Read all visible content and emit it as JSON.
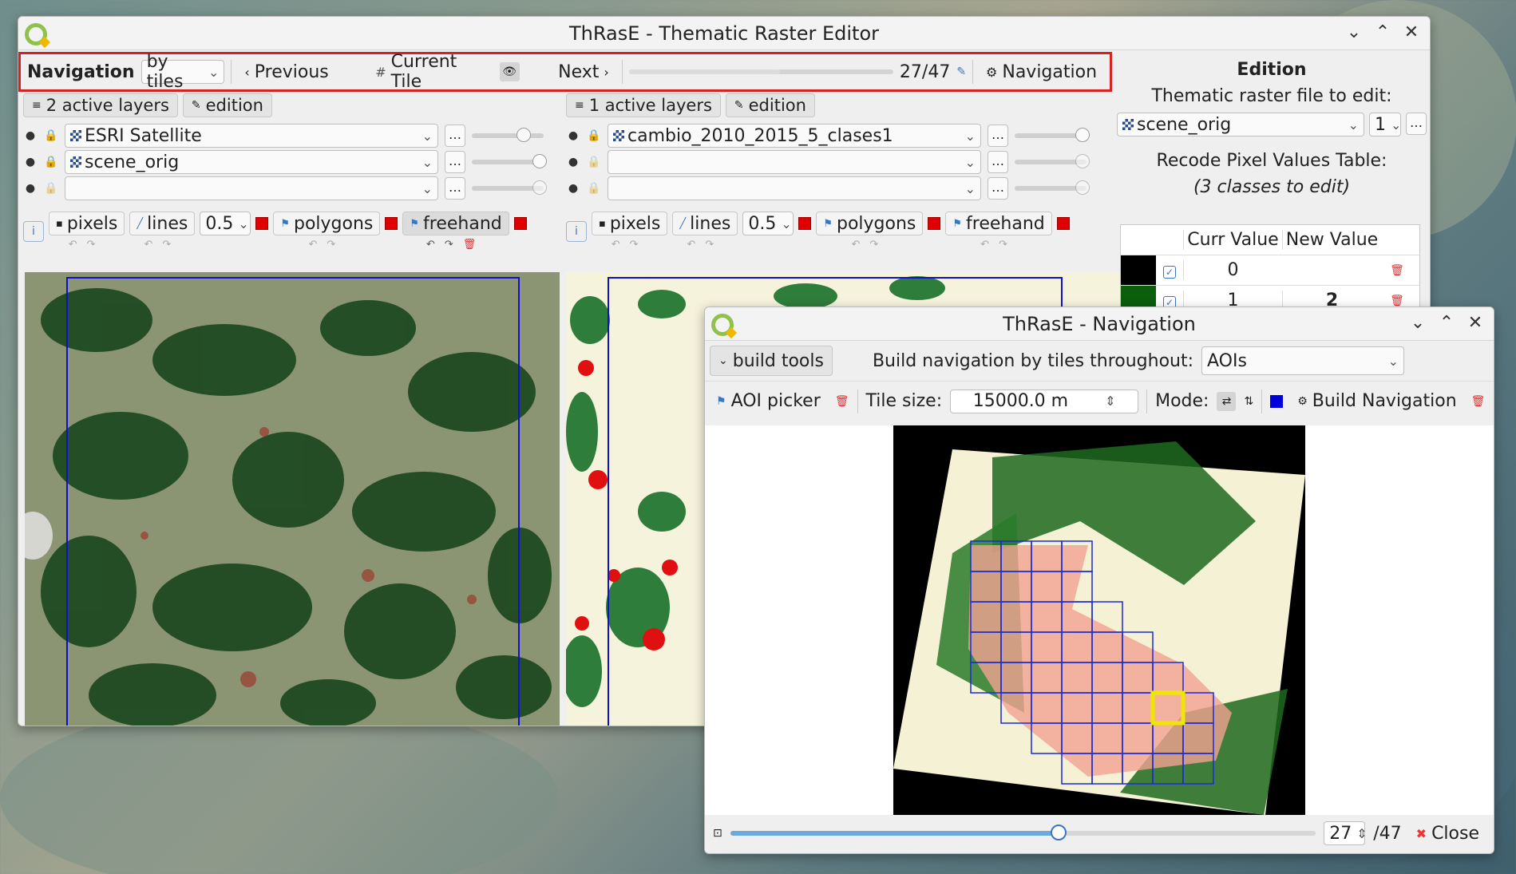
{
  "main_window": {
    "title": "ThRasE - Thematic Raster Editor",
    "nav_toolbar": {
      "label": "Navigation",
      "mode_value": "by tiles",
      "previous_label": "Previous",
      "current_tile_label": "Current Tile",
      "next_label": "Next",
      "progress": "27/47",
      "navigation_button_label": "Navigation"
    },
    "left_view": {
      "active_layers_label": "2 active layers",
      "edition_label": "edition",
      "layers": [
        "ESRI Satellite",
        "scene_orig",
        ""
      ],
      "tools": {
        "pixels": "pixels",
        "lines": "lines",
        "line_width": "0.5",
        "polygons": "polygons",
        "freehand": "freehand"
      }
    },
    "right_view": {
      "active_layers_label": "1 active layers",
      "edition_label": "edition",
      "layers": [
        "cambio_2010_2015_5_clases1",
        "",
        ""
      ],
      "tools": {
        "pixels": "pixels",
        "lines": "lines",
        "line_width": "0.5",
        "polygons": "polygons",
        "freehand": "freehand"
      }
    },
    "edition_panel": {
      "title": "Edition",
      "file_label": "Thematic raster file to edit:",
      "file_value": "scene_orig",
      "band_value": "1",
      "recode_label": "Recode Pixel Values Table:",
      "classes_note": "(3 classes to edit)",
      "columns": [
        "Curr Value",
        "New Value"
      ],
      "rows": [
        {
          "color": "#000000",
          "curr": "0",
          "new": ""
        },
        {
          "color": "#0b5e0b",
          "curr": "1",
          "new": "2"
        }
      ]
    }
  },
  "navigation_dialog": {
    "title": "ThRasE - Navigation",
    "build_tools_label": "build tools",
    "build_by_label": "Build navigation by tiles throughout:",
    "build_by_value": "AOIs",
    "aoi_picker_label": "AOI picker",
    "tile_size_label": "Tile size:",
    "tile_size_value": "15000.0 m",
    "mode_label": "Mode:",
    "build_button_label": "Build Navigation",
    "current_tile": "27",
    "total_tiles": "/47",
    "tile_progress": 0.56,
    "close_label": "Close"
  },
  "colors": {
    "tile_border": "#1010cc",
    "current_tile": "#f2e600",
    "highlight_red": "#d52323"
  }
}
